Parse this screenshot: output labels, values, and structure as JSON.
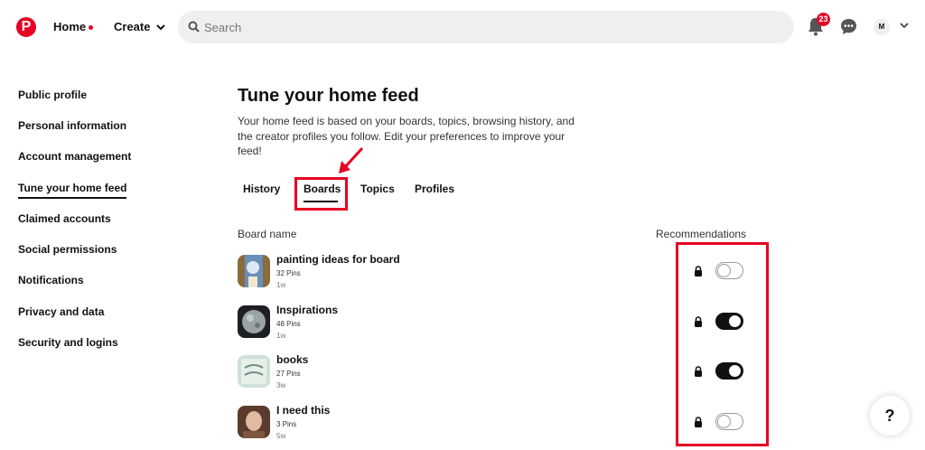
{
  "header": {
    "logo_letter": "P",
    "home_label": "Home",
    "create_label": "Create",
    "search_placeholder": "Search",
    "notification_count": "23",
    "avatar_initial": "M"
  },
  "sidebar": {
    "items": [
      {
        "label": "Public profile"
      },
      {
        "label": "Personal information"
      },
      {
        "label": "Account management"
      },
      {
        "label": "Tune your home feed",
        "active": true
      },
      {
        "label": "Claimed accounts"
      },
      {
        "label": "Social permissions"
      },
      {
        "label": "Notifications"
      },
      {
        "label": "Privacy and data"
      },
      {
        "label": "Security and logins"
      }
    ]
  },
  "main": {
    "title": "Tune your home feed",
    "description": "Your home feed is based on your boards, topics, browsing history, and the creator profiles you follow. Edit your preferences to improve your feed!",
    "tabs": [
      {
        "label": "History"
      },
      {
        "label": "Boards",
        "active": true
      },
      {
        "label": "Topics"
      },
      {
        "label": "Profiles"
      }
    ],
    "columns": {
      "board_name": "Board name",
      "recommendations": "Recommendations"
    },
    "boards": [
      {
        "name": "painting ideas for board",
        "pins": "32 Pins",
        "time": "1w",
        "recommendations_on": false
      },
      {
        "name": "Inspirations",
        "pins": "48 Pins",
        "time": "1w",
        "recommendations_on": true
      },
      {
        "name": "books",
        "pins": "27 Pins",
        "time": "3w",
        "recommendations_on": true
      },
      {
        "name": "I need this",
        "pins": "3 Pins",
        "time": "5w",
        "recommendations_on": false
      }
    ]
  },
  "help_label": "?",
  "colors": {
    "brand": "#e60023",
    "annotation": "#e60023",
    "toggle_on": "#111111"
  }
}
